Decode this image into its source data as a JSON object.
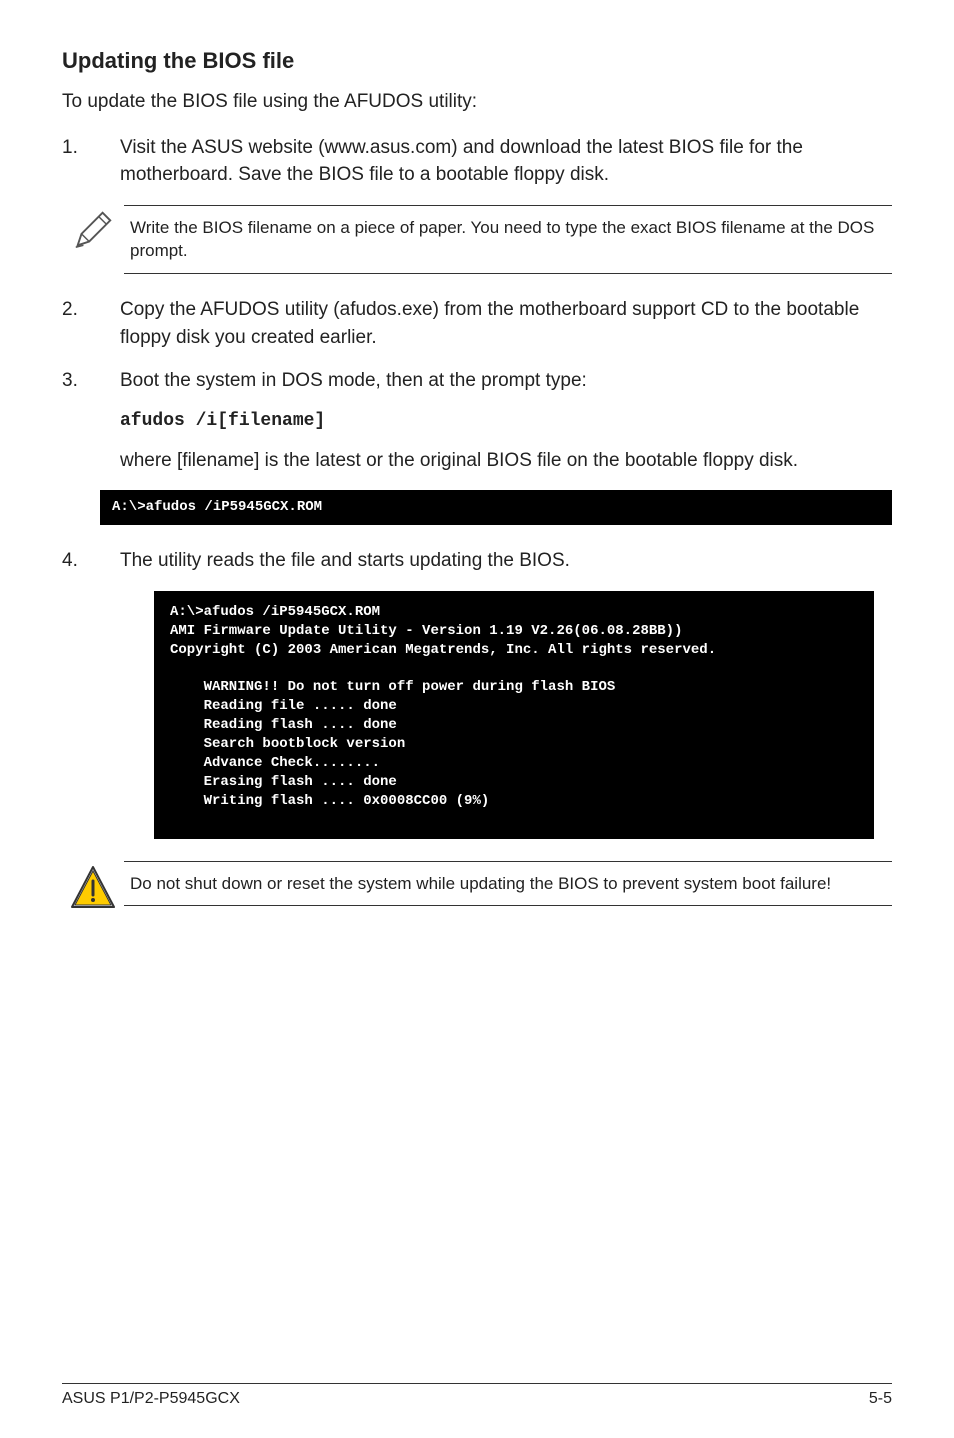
{
  "heading": "Updating the BIOS file",
  "intro": "To update the BIOS file using the AFUDOS utility:",
  "step1_num": "1.",
  "step1_text": "Visit the ASUS website (www.asus.com) and download the latest BIOS file for the motherboard. Save the BIOS file to a bootable floppy disk.",
  "note1": "Write the BIOS filename on a piece of paper. You need to type the exact BIOS filename at the DOS prompt.",
  "step2_num": "2.",
  "step2_text": "Copy the AFUDOS utility (afudos.exe) from the motherboard support CD to the bootable floppy disk you created earlier.",
  "step3_num": "3.",
  "step3_text": "Boot the system in DOS mode, then at the prompt type:",
  "code1": "afudos /i[filename]",
  "step3_cont": "where [filename] is the latest or the original BIOS file on the bootable floppy disk.",
  "terminal1": "A:\\>afudos /iP5945GCX.ROM",
  "step4_num": "4.",
  "step4_text": "The utility reads the file and starts updating the BIOS.",
  "terminal2": "A:\\>afudos /iP5945GCX.ROM\nAMI Firmware Update Utility - Version 1.19 V2.26(06.08.28BB))\nCopyright (C) 2003 American Megatrends, Inc. All rights reserved.\n\n    WARNING!! Do not turn off power during flash BIOS\n    Reading file ..... done\n    Reading flash .... done\n    Search bootblock version\n    Advance Check........\n    Erasing flash .... done\n    Writing flash .... 0x0008CC00 (9%)",
  "warning1": "Do not shut down or reset the system while updating the BIOS to prevent system boot failure!",
  "footer_left": "ASUS P1/P2-P5945GCX",
  "footer_right": "5-5"
}
